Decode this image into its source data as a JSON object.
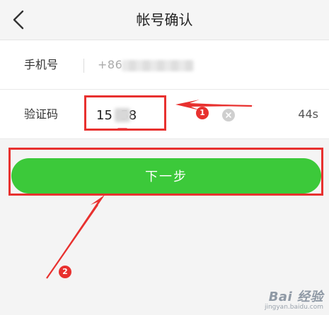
{
  "header": {
    "title": "帐号确认"
  },
  "form": {
    "phone_label": "手机号",
    "phone_value": "+86",
    "code_label": "验证码",
    "code_value": "15  58",
    "countdown": "44s"
  },
  "actions": {
    "next_label": "下一步"
  },
  "annotations": {
    "badge_1": "1",
    "badge_2": "2",
    "accent_color": "#e8312f"
  },
  "watermark": {
    "brand": "Bai  经验",
    "url": "jingyan.baidu.com"
  },
  "colors": {
    "button_green": "#3cc93a",
    "header_bg": "#f5f5f5"
  },
  "icons": {
    "back": "chevron-left-icon",
    "clear": "close-circle-icon"
  }
}
